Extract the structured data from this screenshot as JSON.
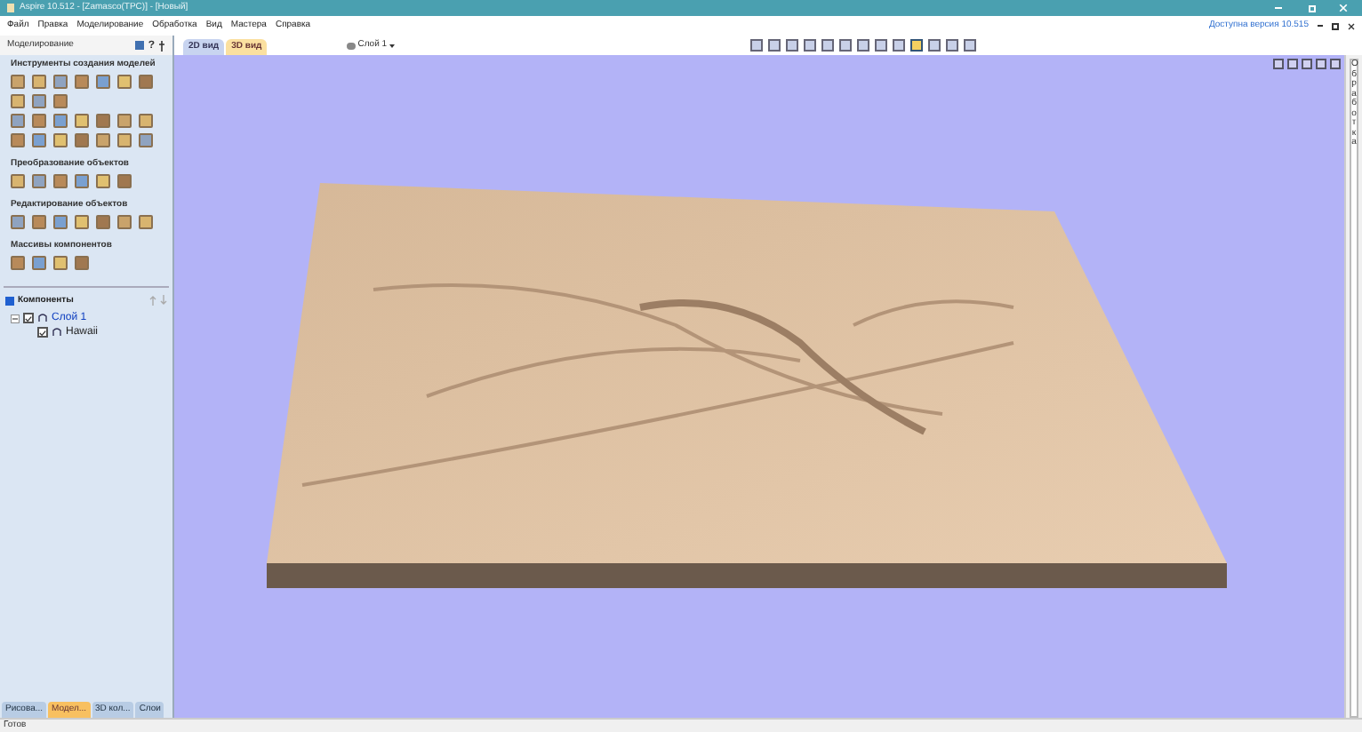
{
  "window": {
    "title": "Aspire 10.512 - [Zamasco(TPC)] - [Новый]"
  },
  "menu": [
    "Файл",
    "Правка",
    "Моделирование",
    "Обработка",
    "Вид",
    "Мастера",
    "Справка"
  ],
  "update_notice": "Доступна версия 10.515",
  "panel": {
    "title": "Моделирование",
    "help": "?",
    "sections": [
      {
        "title": "Инструменты создания моделей"
      },
      {
        "title": "Преобразование объектов"
      },
      {
        "title": "Редактирование объектов"
      },
      {
        "title": "Массивы компонентов"
      }
    ]
  },
  "components": {
    "title": "Компоненты",
    "checked": true,
    "tree": [
      {
        "label": "Слой 1",
        "checked": true,
        "expanded": true,
        "children": [
          {
            "label": "Hawaii",
            "checked": true
          }
        ]
      }
    ]
  },
  "view_tabs": [
    {
      "label": "2D вид",
      "selected": false
    },
    {
      "label": "3D вид",
      "selected": true
    }
  ],
  "layer_select": "Слой 1",
  "side_tab": "Обработка",
  "bottom_tabs": [
    {
      "label": "Рисова...",
      "selected": false
    },
    {
      "label": "Модел...",
      "selected": true
    },
    {
      "label": "3D кол...",
      "selected": false
    },
    {
      "label": "Слои",
      "selected": false
    }
  ],
  "status_bar": "Готов"
}
